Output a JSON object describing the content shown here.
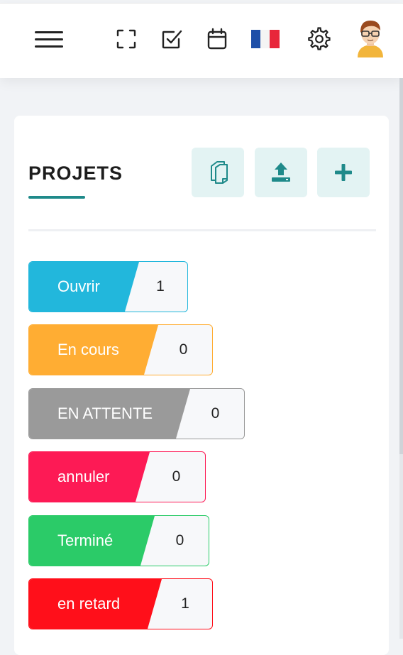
{
  "header": {
    "icons": {
      "menu": "menu-icon",
      "fullscreen": "fullscreen-icon",
      "tasks": "tasks-icon",
      "calendar": "calendar-icon",
      "language": "french-flag-icon",
      "settings": "gear-icon",
      "avatar": "avatar"
    }
  },
  "section": {
    "title": "PROJETS",
    "accent_color": "#1f8a8a",
    "actions": [
      "copy-icon",
      "upload-icon",
      "plus-icon"
    ]
  },
  "statuses": [
    {
      "label": "Ouvrir",
      "count": "1",
      "color": "#22b7dc"
    },
    {
      "label": "En cours",
      "count": "0",
      "color": "#ffad33"
    },
    {
      "label": "EN ATTENTE",
      "count": "0",
      "color": "#9a9a9a"
    },
    {
      "label": "annuler",
      "count": "0",
      "color": "#fd1a55"
    },
    {
      "label": "Terminé",
      "count": "0",
      "color": "#2bcb68"
    },
    {
      "label": "en retard",
      "count": "1",
      "color": "#ff0f1a"
    }
  ]
}
